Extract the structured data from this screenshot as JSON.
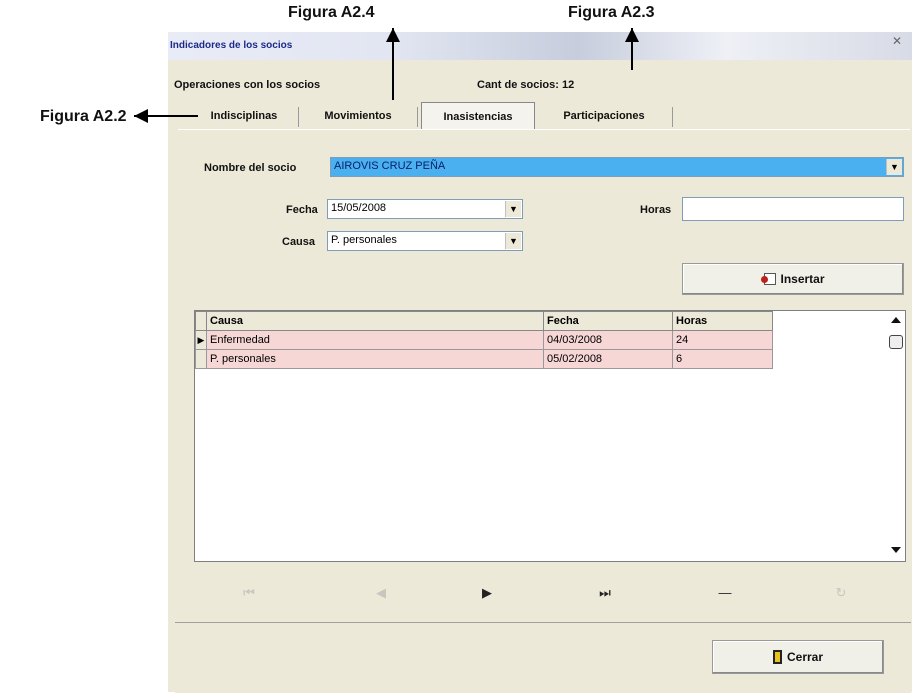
{
  "annotations": {
    "fig_a24": "Figura A2.4",
    "fig_a23": "Figura A2.3",
    "fig_a22": "Figura A2.2"
  },
  "window": {
    "title": "Indicadores de los socios",
    "close": "✕"
  },
  "header": {
    "operations_label": "Operaciones con los socios",
    "count_label": "Cant de socios: 12"
  },
  "tabs": [
    {
      "label": "Indisciplinas",
      "active": false
    },
    {
      "label": "Movimientos",
      "active": false
    },
    {
      "label": "Inasistencias",
      "active": true
    },
    {
      "label": "Participaciones",
      "active": false
    }
  ],
  "form": {
    "nombre_label": "Nombre del socio",
    "nombre_value": "AIROVIS CRUZ PEÑA",
    "fecha_label": "Fecha",
    "fecha_value": "15/05/2008",
    "causa_label": "Causa",
    "causa_value": "P. personales",
    "horas_label": "Horas",
    "horas_value": "",
    "dropdown_glyph": "▼"
  },
  "insert_button": {
    "label": "Insertar",
    "icon": "insert-record-icon"
  },
  "grid": {
    "columns": [
      "Causa",
      "Fecha",
      "Horas"
    ],
    "rows": [
      {
        "causa": "Enfermedad",
        "fecha": "04/03/2008",
        "horas": "24",
        "current": true
      },
      {
        "causa": "P. personales",
        "fecha": "05/02/2008",
        "horas": "6",
        "current": false
      }
    ],
    "row_pointer": "▶"
  },
  "navigator": {
    "first": "⏮",
    "prev": "◀",
    "next": "▶",
    "last": "⏭",
    "delete": "—",
    "refresh": "↻"
  },
  "close_button": {
    "label": "Cerrar",
    "icon": "door-exit-icon"
  },
  "colors": {
    "selected_name_bg": "#4ab0f0",
    "grid_row_bg": "#f7d6d6",
    "window_bg": "#ece9d8"
  }
}
